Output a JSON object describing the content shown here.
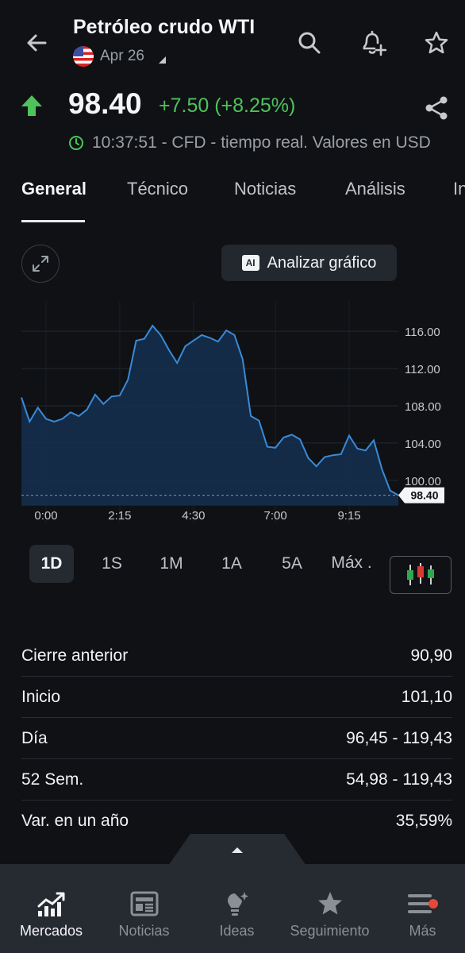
{
  "header": {
    "title": "Petróleo crudo WTI",
    "date_label": "Apr 26"
  },
  "quote": {
    "price": "98.40",
    "change": "+7.50 (+8.25%)",
    "meta": "10:37:51 - CFD - tiempo real. Valores en USD",
    "direction": "up"
  },
  "tabs": [
    "General",
    "Técnico",
    "Noticias",
    "Análisis",
    "In"
  ],
  "chart_controls": {
    "analyze_label": "Analizar gráfico",
    "ai_badge": "AI"
  },
  "chart_data": {
    "type": "area",
    "x": [
      "23:15",
      "23:30",
      "23:45",
      "0:00",
      "0:15",
      "0:30",
      "0:45",
      "1:00",
      "1:15",
      "1:30",
      "1:45",
      "2:00",
      "2:15",
      "2:30",
      "2:45",
      "3:00",
      "3:15",
      "3:30",
      "3:45",
      "4:00",
      "4:15",
      "4:30",
      "4:45",
      "5:00",
      "5:15",
      "5:30",
      "5:45",
      "6:00",
      "6:15",
      "6:30",
      "6:45",
      "7:00",
      "7:15",
      "7:30",
      "7:45",
      "8:00",
      "8:15",
      "8:30",
      "8:45",
      "9:00",
      "9:15",
      "9:30",
      "9:45",
      "10:00",
      "10:15",
      "10:30",
      "10:37"
    ],
    "values": [
      108.9,
      106.3,
      107.8,
      106.6,
      106.3,
      106.6,
      107.3,
      106.9,
      107.6,
      109.2,
      108.2,
      109.0,
      109.1,
      110.8,
      115.0,
      115.2,
      116.6,
      115.6,
      114.0,
      112.6,
      114.4,
      115.0,
      115.6,
      115.3,
      114.9,
      116.1,
      115.6,
      113.0,
      106.9,
      106.4,
      103.6,
      103.5,
      104.6,
      104.9,
      104.4,
      102.4,
      101.5,
      102.5,
      102.7,
      102.8,
      104.8,
      103.4,
      103.2,
      104.3,
      101.2,
      98.9,
      98.4
    ],
    "x_ticks": [
      "0:00",
      "2:15",
      "4:30",
      "7:00",
      "9:15"
    ],
    "y_ticks": [
      "116.00",
      "112.00",
      "108.00",
      "104.00",
      "100.00"
    ],
    "ylim": [
      97,
      119
    ],
    "last_value_label": "98.40",
    "line_color": "#3a8ad8",
    "fill_color": "#14304f",
    "grid": true
  },
  "ranges": [
    "1D",
    "1S",
    "1M",
    "1A",
    "5A",
    "Máx ."
  ],
  "active_range": "1D",
  "stats": [
    {
      "label": "Cierre anterior",
      "value": "90,90"
    },
    {
      "label": "Inicio",
      "value": "101,10"
    },
    {
      "label": "Día",
      "value": "96,45 - 119,43"
    },
    {
      "label": "52 Sem.",
      "value": "54,98 - 119,43"
    },
    {
      "label": "Var. en un año",
      "value": "35,59%"
    }
  ],
  "bottom_nav": [
    {
      "label": "Mercados",
      "icon": "chart-up-icon",
      "active": true
    },
    {
      "label": "Noticias",
      "icon": "newspaper-icon",
      "active": false
    },
    {
      "label": "Ideas",
      "icon": "lightbulb-icon",
      "active": false
    },
    {
      "label": "Seguimiento",
      "icon": "star-icon",
      "active": false
    },
    {
      "label": "Más",
      "icon": "menu-icon",
      "active": false
    }
  ],
  "colors": {
    "background": "#0f1115",
    "positive": "#4ec35a",
    "nav_background": "#262a31",
    "notification_dot": "#e5483b"
  }
}
